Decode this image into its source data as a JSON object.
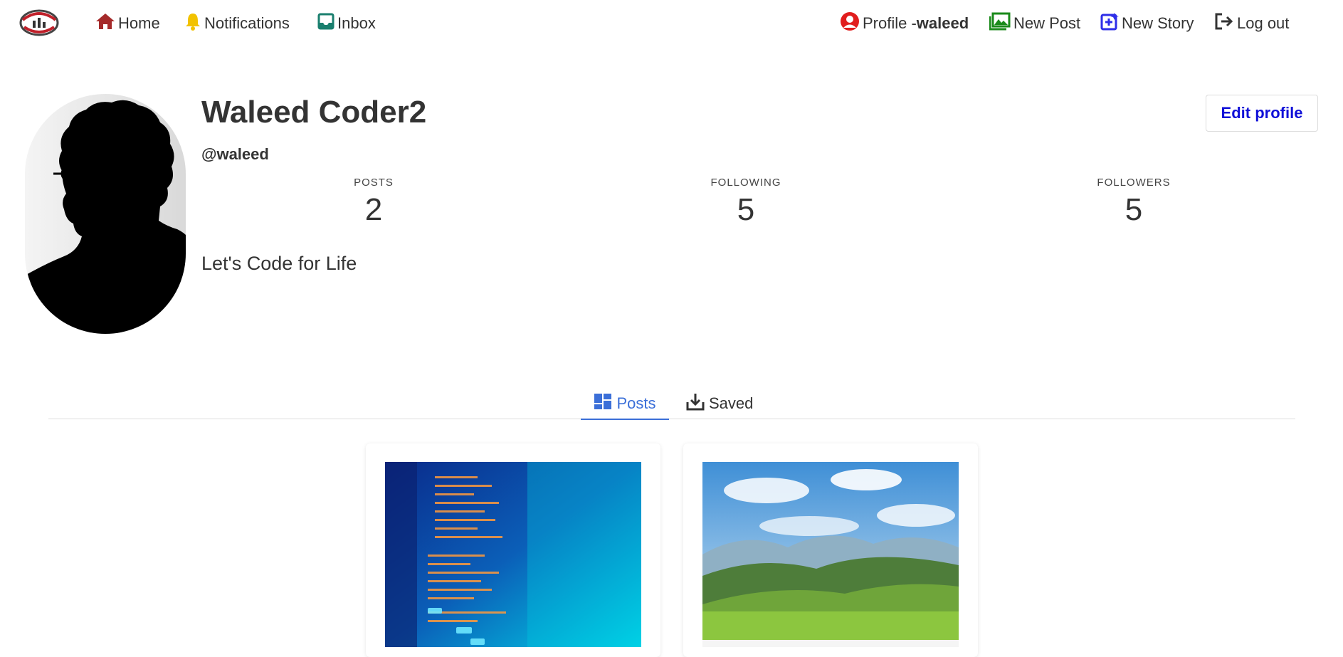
{
  "nav": {
    "home": "Home",
    "notifications": "Notifications",
    "inbox": "Inbox",
    "profile_prefix": "Profile -",
    "profile_user": "waleed",
    "new_post": "New Post",
    "new_story": "New Story",
    "logout": "Log out"
  },
  "profile": {
    "name": "Waleed Coder2",
    "handle": "@waleed",
    "bio": "Let's Code for Life",
    "edit_button": "Edit profile",
    "stats": {
      "posts_label": "POSTS",
      "posts_value": "2",
      "following_label": "FOLLOWING",
      "following_value": "5",
      "followers_label": "FOLLOWERS",
      "followers_value": "5"
    }
  },
  "tabs": {
    "posts": "Posts",
    "saved": "Saved"
  },
  "posts": [
    {
      "image": "code-screen-photo"
    },
    {
      "image": "green-hills-landscape-photo"
    }
  ],
  "icons": {
    "logo": "app-logo-icon",
    "home": "home-icon",
    "notifications": "bell-icon",
    "inbox": "inbox-icon",
    "profile": "user-circle-icon",
    "new_post": "image-add-icon",
    "new_story": "plus-square-icon",
    "logout": "logout-icon",
    "posts_tab": "grid-icon",
    "saved_tab": "download-icon"
  },
  "colors": {
    "home_icon": "#a52a2a",
    "bell_icon": "#f2c200",
    "inbox_icon": "#1a7f6e",
    "profile_icon": "#e11d1d",
    "new_post_icon": "#1a8a1a",
    "new_story_icon": "#2e2ee8",
    "edit_button_text": "#1010d8",
    "active_tab": "#3b6fd8"
  }
}
